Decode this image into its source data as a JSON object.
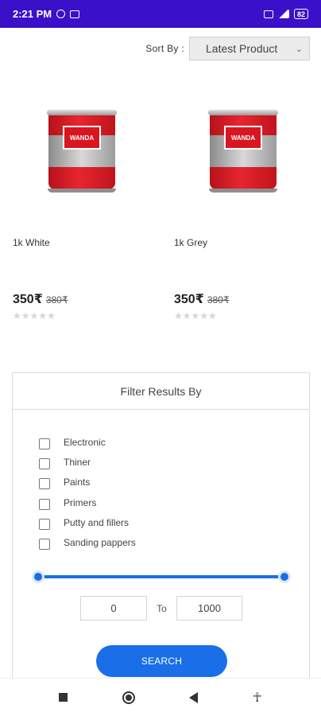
{
  "status_bar": {
    "time": "2:21 PM",
    "battery": "82"
  },
  "sort": {
    "label": "Sort By :",
    "selected": "Latest Product"
  },
  "products": [
    {
      "name": "1k White",
      "price": "350₹",
      "old_price": "380₹",
      "rating": "★★★★★",
      "logo_text": "WANDA"
    },
    {
      "name": "1k Grey",
      "price": "350₹",
      "old_price": "380₹",
      "rating": "★★★★★",
      "logo_text": "WANDA"
    }
  ],
  "filter": {
    "title": "Filter Results By",
    "categories": [
      "Electronic",
      "Thiner",
      "Paints",
      "Primers",
      "Putty and fillers",
      "Sanding pappers"
    ],
    "price_min": "0",
    "price_max": "1000",
    "to_label": "To",
    "search_label": "SEARCH"
  },
  "colors": {
    "status_bar": "#3a10c9",
    "accent": "#1a6fe8"
  },
  "icons": [
    "alarm-icon",
    "notification-icon",
    "wifi-icon",
    "signal-icon",
    "battery-icon",
    "recents-icon",
    "home-icon",
    "back-icon",
    "accessibility-icon"
  ]
}
